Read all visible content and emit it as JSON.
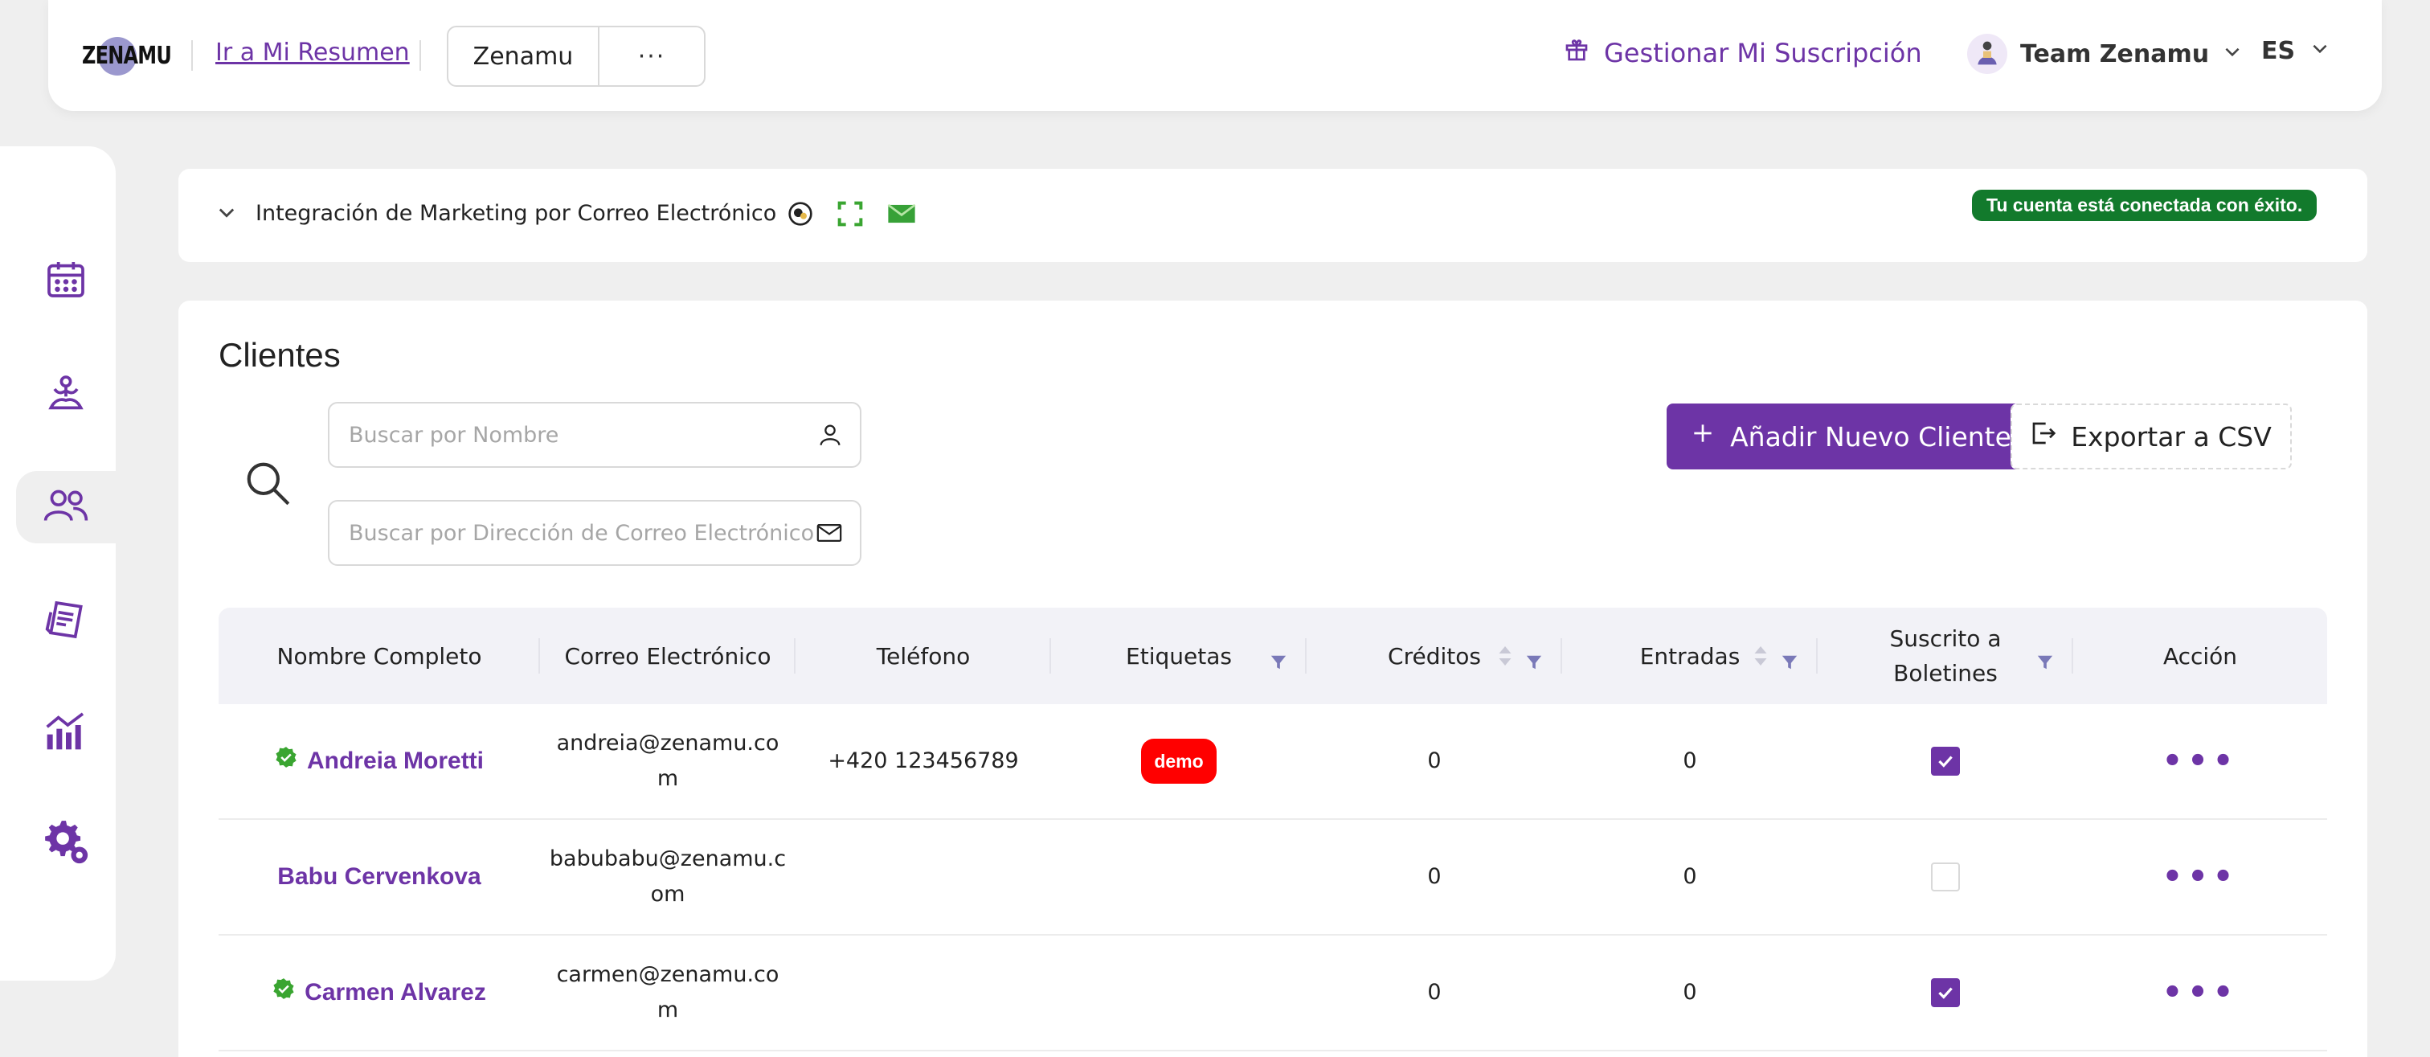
{
  "header": {
    "logo_text": "ZENAMU",
    "resumen_link": "Ir a Mi Resumen",
    "workspace": "Zenamu",
    "workspace_more": "···",
    "subscription": "Gestionar Mi Suscripción",
    "team": "Team Zenamu",
    "language": "ES"
  },
  "sidebar": {
    "items": [
      {
        "icon": "calendar-icon"
      },
      {
        "icon": "yoga-icon"
      },
      {
        "icon": "clients-icon",
        "active": true
      },
      {
        "icon": "invoice-icon"
      },
      {
        "icon": "analytics-icon"
      },
      {
        "icon": "settings-icon"
      }
    ]
  },
  "integration": {
    "title": "Integración de Marketing por Correo Electrónico",
    "status": "Tu cuenta está conectada con éxito."
  },
  "clients": {
    "title": "Clientes",
    "search_name_placeholder": "Buscar por Nombre",
    "search_email_placeholder": "Buscar por Dirección de Correo Electrónico",
    "add_button": "Añadir Nuevo Cliente",
    "export_button": "Exportar a CSV"
  },
  "table": {
    "columns": [
      "Nombre Completo",
      "Correo Electrónico",
      "Teléfono",
      "Etiquetas",
      "Créditos",
      "Entradas",
      "Suscrito a Boletines",
      "Acción"
    ],
    "rows": [
      {
        "name": "Andreia Moretti",
        "verified": true,
        "email": "andreia@zenamu.com",
        "email_display_1": "andreia@zenamu.co",
        "email_display_2": "m",
        "phone": "+420 123456789",
        "tag": "demo",
        "credits": "0",
        "entries": "0",
        "subscribed": true,
        "action": "•••"
      },
      {
        "name": "Babu Cervenkova",
        "verified": false,
        "email": "babubabu@zenamu.com",
        "email_display_1": "babubabu@zenamu.c",
        "email_display_2": "om",
        "phone": "",
        "tag": "",
        "credits": "0",
        "entries": "0",
        "subscribed": false,
        "action": "•••"
      },
      {
        "name": "Carmen Alvarez",
        "verified": true,
        "email": "carmen@zenamu.com",
        "email_display_1": "carmen@zenamu.co",
        "email_display_2": "m",
        "phone": "",
        "tag": "",
        "credits": "0",
        "entries": "0",
        "subscribed": true,
        "action": "•••"
      }
    ]
  },
  "colors": {
    "accent": "#6d34a6",
    "success": "#127a2c",
    "tag_demo": "#ff0000",
    "background": "#efefef"
  }
}
